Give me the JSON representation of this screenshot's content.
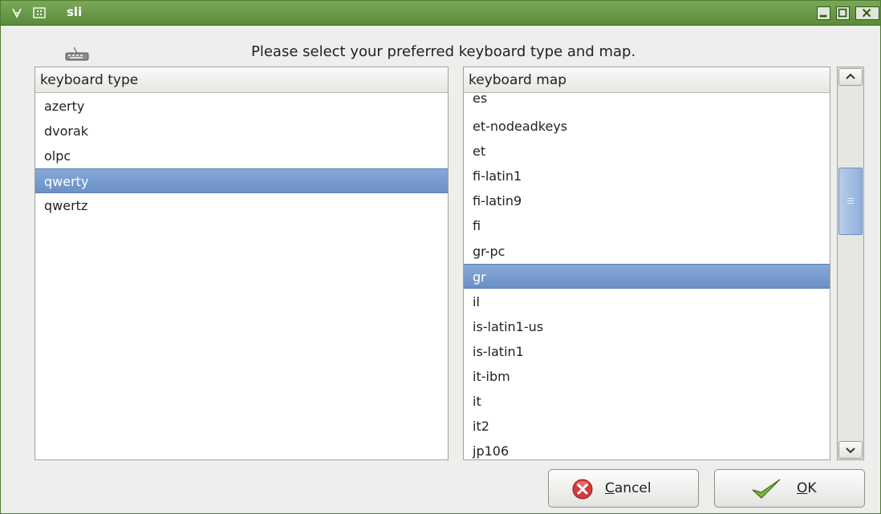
{
  "window": {
    "title": "sli",
    "app_icon": "sli-logo-icon",
    "menu_icon": "window-menu-icon",
    "controls": [
      "minimize-icon",
      "maximize-icon",
      "close-icon"
    ]
  },
  "header": {
    "icon": "keyboard-icon",
    "prompt": "Please select your preferred keyboard type and map."
  },
  "keyboard_type": {
    "header": "keyboard type",
    "items": [
      "azerty",
      "dvorak",
      "olpc",
      "qwerty",
      "qwertz"
    ],
    "selected": "qwerty"
  },
  "keyboard_map": {
    "header": "keyboard map",
    "items": [
      "es",
      "et-nodeadkeys",
      "et",
      "fi-latin1",
      "fi-latin9",
      "fi",
      "gr-pc",
      "gr",
      "il",
      "is-latin1-us",
      "is-latin1",
      "it-ibm",
      "it",
      "it2",
      "jp106"
    ],
    "selected": "gr"
  },
  "scrollbar": {
    "up_icon": "scroll-up-icon",
    "down_icon": "scroll-down-icon",
    "grip_icon": "grip-icon"
  },
  "buttons": {
    "cancel_label": "Cancel",
    "cancel_icon": "cancel-icon",
    "ok_label": "OK",
    "ok_icon": "checkmark-icon"
  },
  "colors": {
    "titlebar": "#6a9a4a",
    "selection": "#7b9dd0"
  }
}
